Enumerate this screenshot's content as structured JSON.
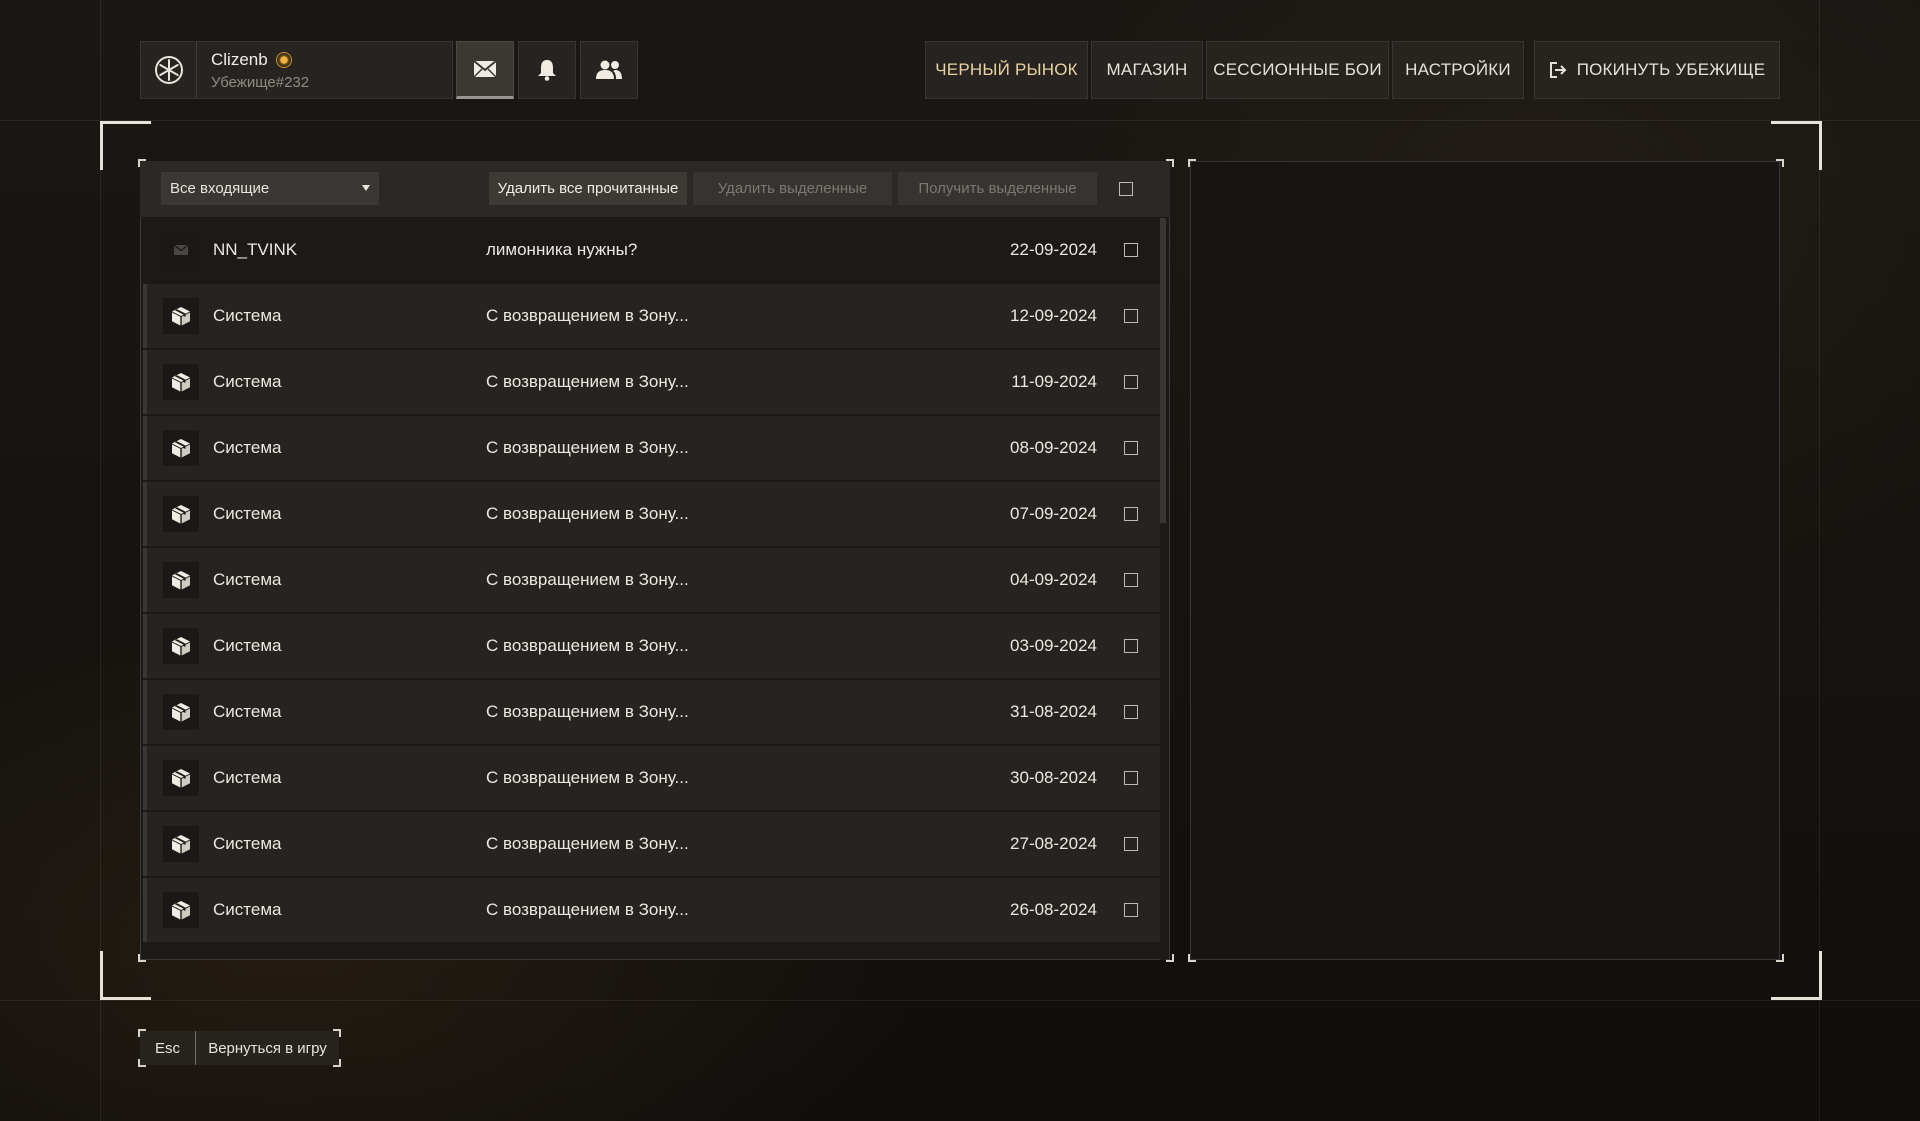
{
  "user": {
    "name": "Clizenb",
    "shelter": "Убежище#232"
  },
  "nav": {
    "black_market": "ЧЕРНЫЙ РЫНОК",
    "shop": "МАГАЗИН",
    "session_battles": "СЕССИОННЫЕ БОИ",
    "settings": "НАСТРОЙКИ",
    "leave_shelter": "ПОКИНУТЬ УБЕЖИЩЕ"
  },
  "toolbar": {
    "filter_value": "Все входящие",
    "delete_read": "Удалить все прочитанные",
    "delete_selected": "Удалить выделенные",
    "receive_selected": "Получить выделенные"
  },
  "messages": [
    {
      "sender": "NN_TVINK",
      "subject": "лимонника нужны?",
      "date": "22-09-2024",
      "icon": "envelope-icon"
    },
    {
      "sender": "Система",
      "subject": "С возвращением в Зону...",
      "date": "12-09-2024",
      "icon": "box-icon"
    },
    {
      "sender": "Система",
      "subject": "С возвращением в Зону...",
      "date": "11-09-2024",
      "icon": "box-icon"
    },
    {
      "sender": "Система",
      "subject": "С возвращением в Зону...",
      "date": "08-09-2024",
      "icon": "box-icon"
    },
    {
      "sender": "Система",
      "subject": "С возвращением в Зону...",
      "date": "07-09-2024",
      "icon": "box-icon"
    },
    {
      "sender": "Система",
      "subject": "С возвращением в Зону...",
      "date": "04-09-2024",
      "icon": "box-icon"
    },
    {
      "sender": "Система",
      "subject": "С возвращением в Зону...",
      "date": "03-09-2024",
      "icon": "box-icon"
    },
    {
      "sender": "Система",
      "subject": "С возвращением в Зону...",
      "date": "31-08-2024",
      "icon": "box-icon"
    },
    {
      "sender": "Система",
      "subject": "С возвращением в Зону...",
      "date": "30-08-2024",
      "icon": "box-icon"
    },
    {
      "sender": "Система",
      "subject": "С возвращением в Зону...",
      "date": "27-08-2024",
      "icon": "box-icon"
    },
    {
      "sender": "Система",
      "subject": "С возвращением в Зону...",
      "date": "26-08-2024",
      "icon": "box-icon"
    }
  ],
  "footer": {
    "key": "Esc",
    "label": "Вернуться в игру"
  },
  "colors": {
    "accent_gold": "#e8d2a0",
    "badge": "#f0b040",
    "panel": "#262421"
  }
}
